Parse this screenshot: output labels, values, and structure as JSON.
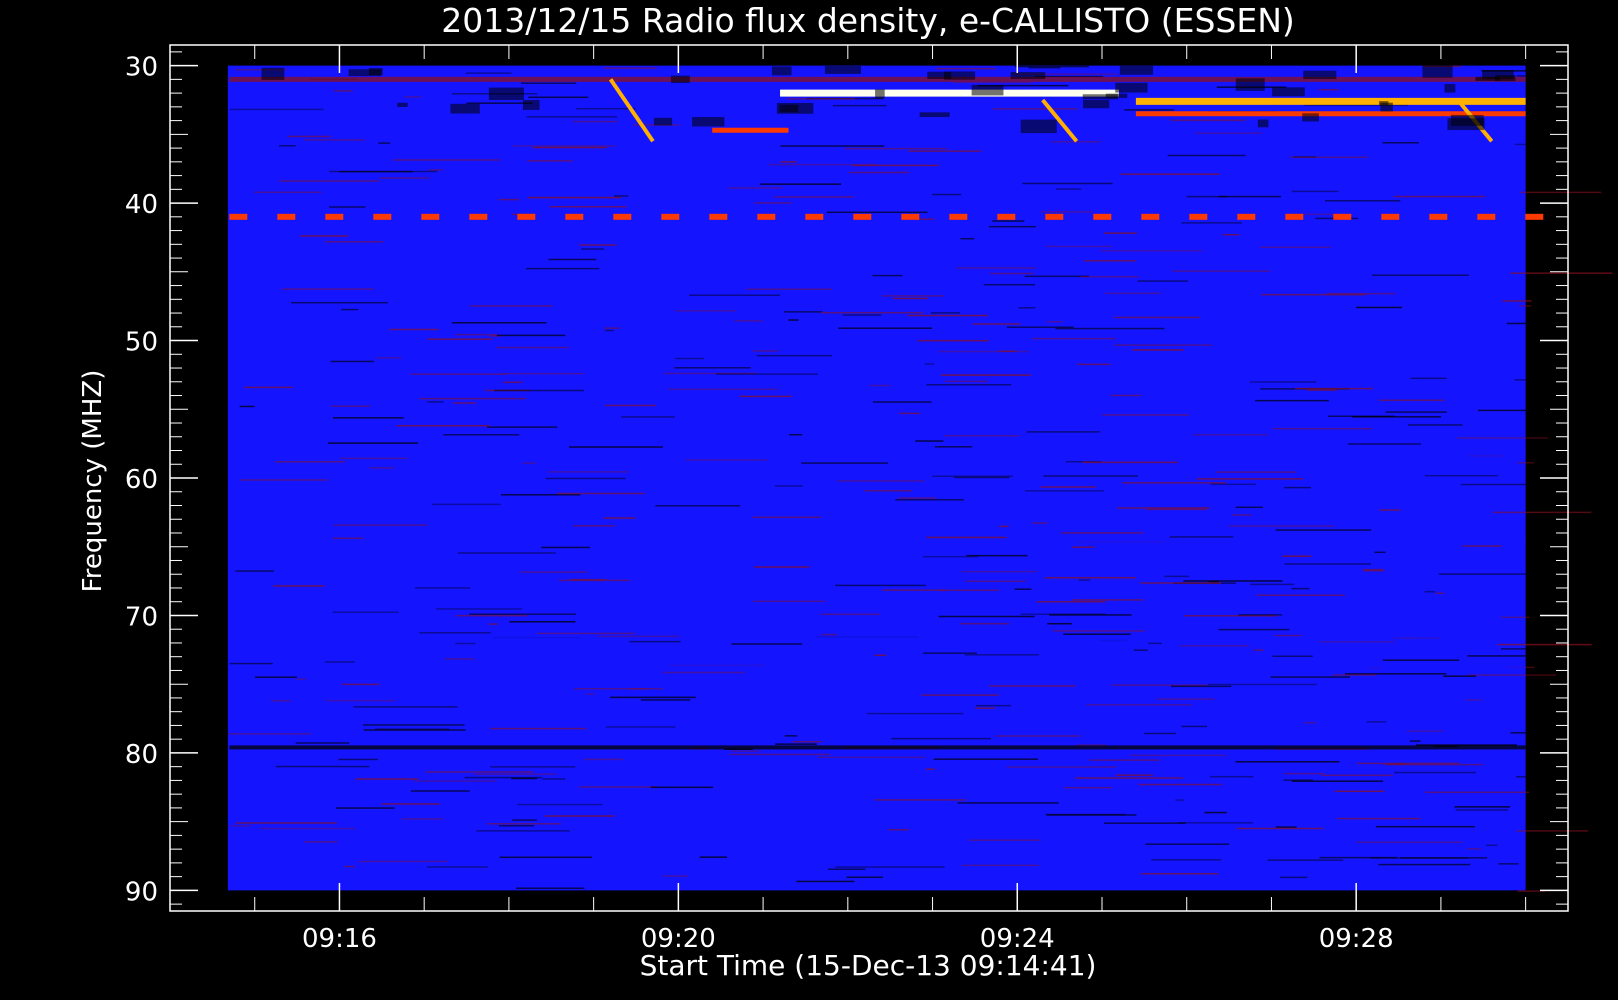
{
  "chart_data": {
    "type": "heatmap",
    "title": "2013/12/15  Radio flux density, e-CALLISTO (ESSEN)",
    "xlabel": "Start Time (15-Dec-13 09:14:41)",
    "ylabel": "Frequency (MHZ)",
    "x_start_minutes": 554.683,
    "x_end_minutes": 570.0,
    "xlim_minutes": [
      554.0,
      570.5
    ],
    "ylim": [
      28.5,
      91.5
    ],
    "y_reversed": true,
    "data_freq_range": [
      30,
      90
    ],
    "x_ticks": [
      {
        "minutes": 556,
        "label": "09:16"
      },
      {
        "minutes": 560,
        "label": "09:20"
      },
      {
        "minutes": 564,
        "label": "09:24"
      },
      {
        "minutes": 568,
        "label": "09:28"
      }
    ],
    "y_ticks": [
      30,
      40,
      50,
      60,
      70,
      80,
      90
    ],
    "colormap": [
      "#000000",
      "#1414ff",
      "#8a1020",
      "#ff3a00",
      "#ffb000",
      "#ffffee"
    ],
    "background_color": "#1414ff",
    "features": [
      {
        "kind": "band",
        "freq": 32.0,
        "t_start": 561.2,
        "t_end": 565.2,
        "intensity": 5
      },
      {
        "kind": "band",
        "freq": 32.6,
        "t_start": 565.4,
        "t_end": 570.0,
        "intensity": 4
      },
      {
        "kind": "band",
        "freq": 31.0,
        "t_start": 554.7,
        "t_end": 570.0,
        "intensity": 2
      },
      {
        "kind": "band",
        "freq": 34.7,
        "t_start": 560.4,
        "t_end": 561.3,
        "intensity": 3
      },
      {
        "kind": "band",
        "freq": 33.5,
        "t_start": 565.4,
        "t_end": 570.0,
        "intensity": 3
      },
      {
        "kind": "dashed_band",
        "freq": 41.0,
        "t_start": 554.7,
        "t_end": 570.0,
        "intensity": 3
      },
      {
        "kind": "band",
        "freq": 58.2,
        "t_start": 554.7,
        "t_end": 570.0,
        "intensity": 1
      },
      {
        "kind": "band",
        "freq": 64.6,
        "t_start": 554.7,
        "t_end": 570.0,
        "intensity": 1
      },
      {
        "kind": "band",
        "freq": 71.7,
        "t_start": 554.7,
        "t_end": 570.0,
        "intensity": 1
      },
      {
        "kind": "band",
        "freq": 73.8,
        "t_start": 554.7,
        "t_end": 570.0,
        "intensity": 1
      },
      {
        "kind": "band",
        "freq": 79.6,
        "t_start": 554.7,
        "t_end": 570.0,
        "intensity": 0
      },
      {
        "kind": "drift",
        "t_start": 559.2,
        "f_start": 31.0,
        "t_end": 559.7,
        "f_end": 35.5,
        "intensity": 4
      },
      {
        "kind": "drift",
        "t_start": 564.3,
        "f_start": 32.5,
        "t_end": 564.7,
        "f_end": 35.5,
        "intensity": 4
      },
      {
        "kind": "drift",
        "t_start": 569.2,
        "f_start": 32.5,
        "t_end": 569.6,
        "f_end": 35.5,
        "intensity": 4
      },
      {
        "kind": "dark_region",
        "f_start": 30,
        "f_end": 34,
        "t_start": 554.7,
        "t_end": 570.0,
        "intensity": 0
      }
    ]
  }
}
